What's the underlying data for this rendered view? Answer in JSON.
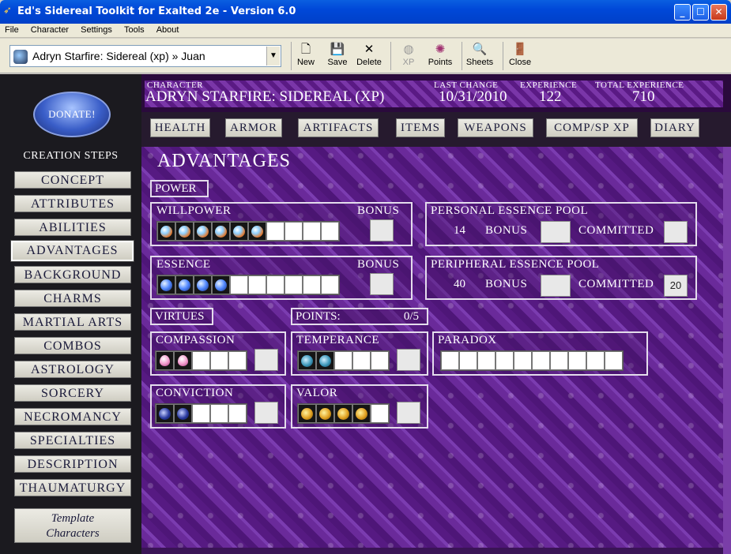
{
  "window": {
    "title": "Ed's Sidereal Toolkit for Exalted 2e - Version 6.0"
  },
  "menu": [
    "File",
    "Character",
    "Settings",
    "Tools",
    "About"
  ],
  "toolbar": {
    "character_select": "Adryn Starfire: Sidereal (xp) » Juan",
    "buttons": [
      {
        "label": "New",
        "icon": "new-document-icon",
        "enabled": true
      },
      {
        "label": "Save",
        "icon": "save-disk-icon",
        "enabled": true
      },
      {
        "label": "Delete",
        "icon": "delete-x-icon",
        "enabled": true
      },
      {
        "label": "XP",
        "icon": "xp-icon",
        "enabled": false
      },
      {
        "label": "Points",
        "icon": "points-icon",
        "enabled": true
      },
      {
        "label": "Sheets",
        "icon": "sheets-icon",
        "enabled": true
      },
      {
        "label": "Close",
        "icon": "close-door-icon",
        "enabled": true
      }
    ]
  },
  "sidebar": {
    "donate_label": "DONATE!",
    "creation_steps_label": "CREATION STEPS",
    "steps": [
      "CONCEPT",
      "ATTRIBUTES",
      "ABILITIES",
      "ADVANTAGES",
      "BACKGROUND",
      "CHARMS",
      "MARTIAL ARTS",
      "COMBOS",
      "ASTROLOGY",
      "SORCERY",
      "NECROMANCY",
      "SPECIALTIES",
      "DESCRIPTION",
      "THAUMATURGY"
    ],
    "active_step": "ADVANTAGES",
    "template_line1": "Template",
    "template_line2": "Characters"
  },
  "header": {
    "character_label": "CHARACTER",
    "character_value": "ADRYN STARFIRE: SIDEREAL (XP)",
    "last_change_label": "LAST CHANGE",
    "last_change_value": "10/31/2010",
    "experience_label": "EXPERIENCE",
    "experience_value": "122",
    "total_experience_label": "TOTAL EXPERIENCE",
    "total_experience_value": "710"
  },
  "tabs": [
    "HEALTH",
    "ARMOR",
    "ARTIFACTS",
    "ITEMS",
    "WEAPONS",
    "COMP/SP XP",
    "DIARY"
  ],
  "advantages": {
    "title": "ADVANTAGES",
    "power_label": "POWER",
    "bonus_label": "BONUS",
    "committed_label": "COMMITTED",
    "willpower": {
      "label": "WILLPOWER",
      "value": 6,
      "max": 10
    },
    "essence": {
      "label": "ESSENCE",
      "value": 4,
      "max": 10
    },
    "personal_pool": {
      "label": "PERSONAL ESSENCE POOL",
      "value": "14",
      "bonus": "",
      "committed": ""
    },
    "peripheral_pool": {
      "label": "PERIPHERAL ESSENCE POOL",
      "value": "40",
      "bonus": "",
      "committed": "20"
    },
    "virtues_label": "VIRTUES",
    "points_label": "POINTS:",
    "points_value": "0/5",
    "virtues": {
      "compassion": {
        "label": "COMPASSION",
        "value": 2,
        "max": 5
      },
      "temperance": {
        "label": "TEMPERANCE",
        "value": 2,
        "max": 5
      },
      "conviction": {
        "label": "CONVICTION",
        "value": 2,
        "max": 5
      },
      "valor": {
        "label": "VALOR",
        "value": 4,
        "max": 5
      }
    },
    "paradox": {
      "label": "PARADOX",
      "value": 0,
      "max": 10
    }
  },
  "colors": {
    "accent_purple": "#5a1f88",
    "titlebar_blue": "#0048d8",
    "panel_border": "#e4dcec"
  }
}
